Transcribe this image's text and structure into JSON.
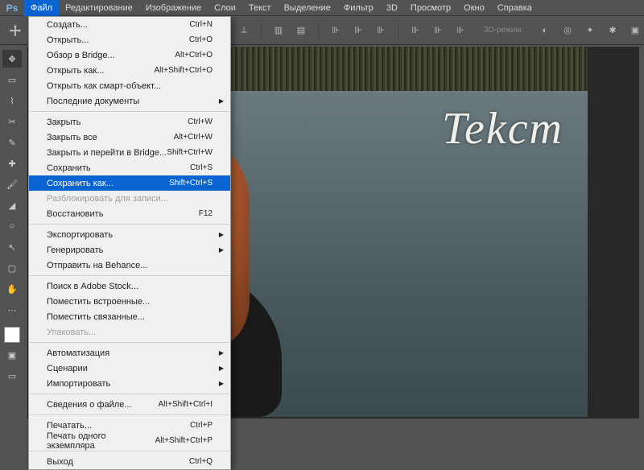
{
  "app": {
    "logo": "Ps"
  },
  "menubar": {
    "items": [
      "Файл",
      "Редактирование",
      "Изображение",
      "Слои",
      "Текст",
      "Выделение",
      "Фильтр",
      "3D",
      "Просмотр",
      "Окно",
      "Справка"
    ],
    "active": 0
  },
  "optbar": {
    "mode3d": "3D-режим:"
  },
  "canvas": {
    "sign_text": "Tekcm"
  },
  "menu": {
    "groups": [
      [
        {
          "label": "Создать...",
          "sc": "Ctrl+N"
        },
        {
          "label": "Открыть...",
          "sc": "Ctrl+O"
        },
        {
          "label": "Обзор в Bridge...",
          "sc": "Alt+Ctrl+O"
        },
        {
          "label": "Открыть как...",
          "sc": "Alt+Shift+Ctrl+O"
        },
        {
          "label": "Открыть как смарт-объект..."
        },
        {
          "label": "Последние документы",
          "sub": true
        }
      ],
      [
        {
          "label": "Закрыть",
          "sc": "Ctrl+W"
        },
        {
          "label": "Закрыть все",
          "sc": "Alt+Ctrl+W"
        },
        {
          "label": "Закрыть и перейти в Bridge...",
          "sc": "Shift+Ctrl+W"
        },
        {
          "label": "Сохранить",
          "sc": "Ctrl+S"
        },
        {
          "label": "Сохранить как...",
          "sc": "Shift+Ctrl+S",
          "hl": true
        },
        {
          "label": "Разблокировать для записи...",
          "disabled": true
        },
        {
          "label": "Восстановить",
          "sc": "F12"
        }
      ],
      [
        {
          "label": "Экспортировать",
          "sub": true
        },
        {
          "label": "Генерировать",
          "sub": true
        },
        {
          "label": "Отправить на Behance..."
        }
      ],
      [
        {
          "label": "Поиск в Adobe Stock..."
        },
        {
          "label": "Поместить встроенные..."
        },
        {
          "label": "Поместить связанные..."
        },
        {
          "label": "Упаковать...",
          "disabled": true
        }
      ],
      [
        {
          "label": "Автоматизация",
          "sub": true
        },
        {
          "label": "Сценарии",
          "sub": true
        },
        {
          "label": "Импортировать",
          "sub": true
        }
      ],
      [
        {
          "label": "Сведения о файле...",
          "sc": "Alt+Shift+Ctrl+I"
        }
      ],
      [
        {
          "label": "Печатать...",
          "sc": "Ctrl+P"
        },
        {
          "label": "Печать одного экземпляра",
          "sc": "Alt+Shift+Ctrl+P"
        }
      ],
      [
        {
          "label": "Выход",
          "sc": "Ctrl+Q"
        }
      ]
    ]
  }
}
